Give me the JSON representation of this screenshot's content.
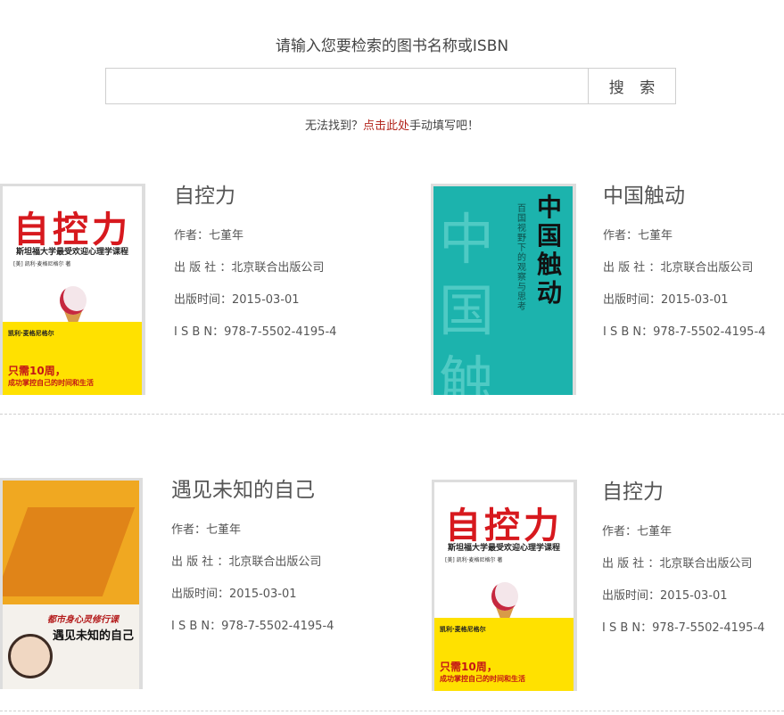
{
  "search": {
    "prompt": "请输入您要检索的图书名称或ISBN",
    "placeholder": "",
    "value": "",
    "button_label": "搜 索"
  },
  "notfound": {
    "prefix": "无法找到？",
    "link": "点击此处",
    "suffix": "手动填写吧！"
  },
  "books": [
    {
      "title": "自控力",
      "author": "作者：七堇年",
      "publisher": "出 版 社 ：北京联合出版公司",
      "date": "出版时间：2015-03-01",
      "isbn": "I S B N：978-7-5502-4195-4",
      "cover": {
        "big": "自控力",
        "sub": "斯坦福大学最受欢迎心理学课程",
        "auth": "[美] 凯利·麦格尼格尔 著",
        "y1": "凯利·麦格尼格尔",
        "y2": "只需10周，",
        "y3": "成功掌控自己的时间和生活"
      }
    },
    {
      "title": "中国触动",
      "author": "作者：七堇年",
      "publisher": "出 版 社 ：北京联合出版公司",
      "date": "出版时间：2015-03-01",
      "isbn": "I S B N：978-7-5502-4195-4",
      "cover": {
        "big": "中国触动",
        "vt": "百国视野下的观察与思考",
        "ghost": "中国触动"
      }
    },
    {
      "title": "遇见未知的自己",
      "author": "作者：七堇年",
      "publisher": "出 版 社 ：北京联合出版公司",
      "date": "出版时间：2015-03-01",
      "isbn": "I S B N：978-7-5502-4195-4",
      "cover": {
        "t1": "都市身心灵修行课",
        "t2": "遇见未知的自己"
      }
    },
    {
      "title": "自控力",
      "author": "作者：七堇年",
      "publisher": "出 版 社 ：北京联合出版公司",
      "date": "出版时间：2015-03-01",
      "isbn": "I S B N：978-7-5502-4195-4",
      "cover": {
        "big": "自控力",
        "sub": "斯坦福大学最受欢迎心理学课程",
        "auth": "[美] 凯利·麦格尼格尔 著",
        "y1": "凯利·麦格尼格尔",
        "y2": "只需10周，",
        "y3": "成功掌控自己的时间和生活"
      }
    }
  ],
  "colors": {
    "link": "#b3261e",
    "accent_red": "#d7191e"
  }
}
